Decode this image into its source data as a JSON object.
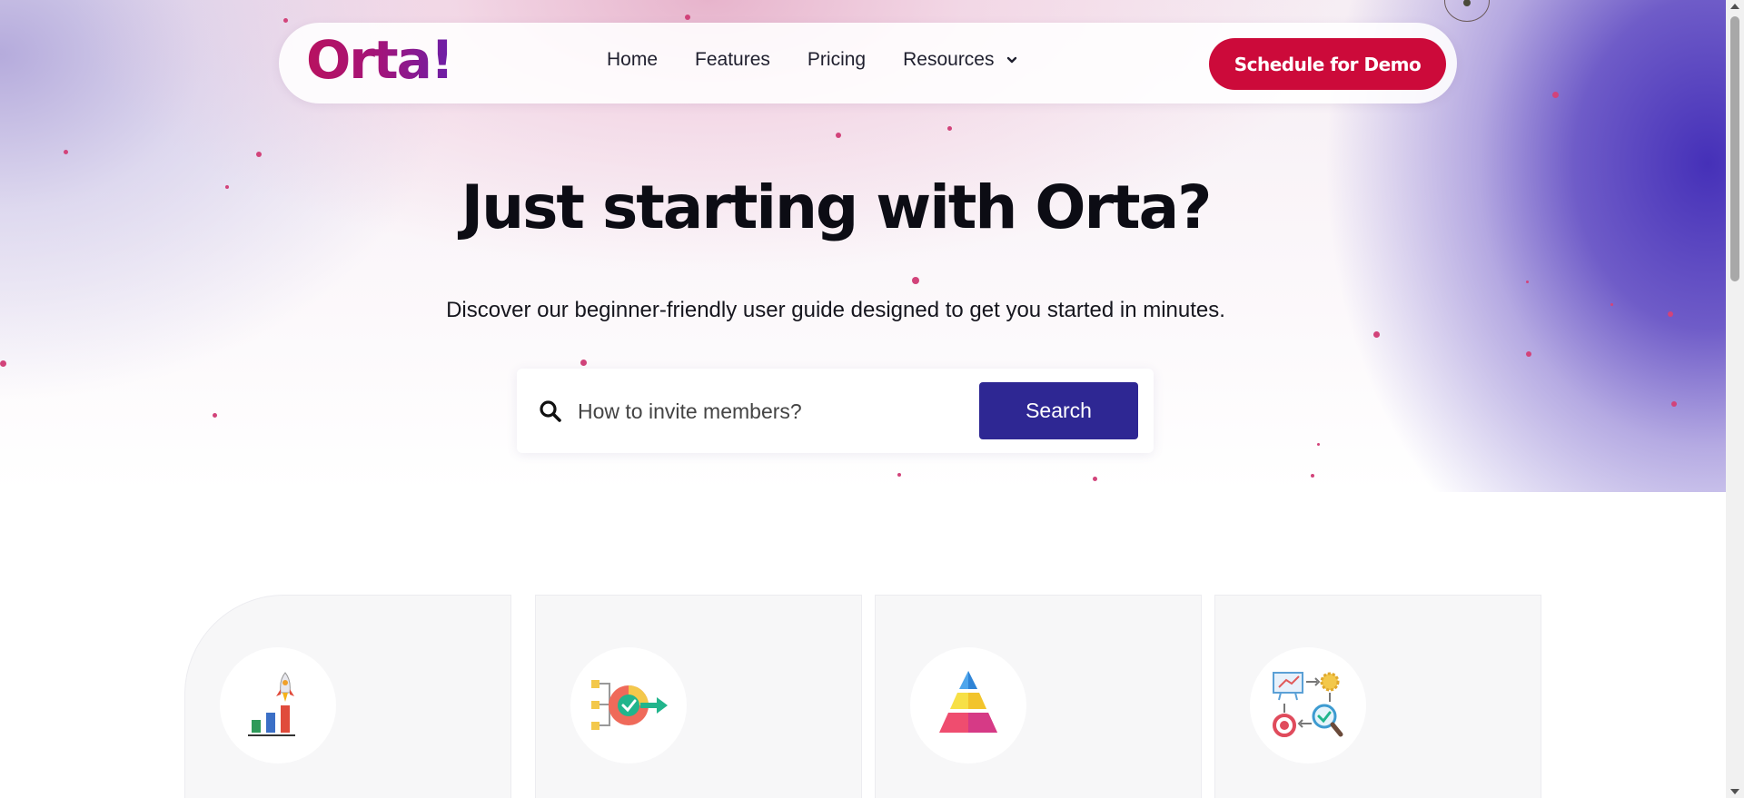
{
  "brand": {
    "logo_text": "Orta!"
  },
  "nav": {
    "items": [
      {
        "label": "Home"
      },
      {
        "label": "Features"
      },
      {
        "label": "Pricing"
      },
      {
        "label": "Resources"
      }
    ],
    "demo_button": "Schedule for Demo"
  },
  "hero": {
    "title": "Just starting with Orta?",
    "subtitle": "Discover our beginner-friendly user guide designed to get you started in minutes."
  },
  "search": {
    "placeholder": "How to invite members?",
    "button_label": "Search"
  },
  "cards": [
    {
      "icon": "rocket-growth-chart-icon"
    },
    {
      "icon": "target-process-icon"
    },
    {
      "icon": "pyramid-icon"
    },
    {
      "icon": "workflow-strategy-icon"
    }
  ],
  "colors": {
    "primary_red": "#cc0a3a",
    "search_button": "#2e2793",
    "hero_purple": "#4530b8"
  }
}
